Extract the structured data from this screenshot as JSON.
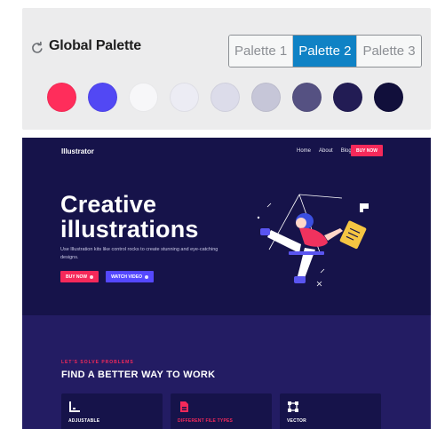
{
  "palette": {
    "title": "Global Palette",
    "tabs": [
      {
        "label": "Palette 1",
        "active": false
      },
      {
        "label": "Palette 2",
        "active": true
      },
      {
        "label": "Palette 3",
        "active": false
      }
    ],
    "swatches": [
      "#ff2d5b",
      "#5248f4",
      "#f7f7f9",
      "#ececf4",
      "#dcdcea",
      "#c6c6d8",
      "#555182",
      "#221c54",
      "#110f3b"
    ]
  },
  "site": {
    "logo": "Illustrator",
    "nav": [
      "Home",
      "About",
      "Blog"
    ],
    "nav_button": "BUY NOW",
    "hero_title_line1": "Creative",
    "hero_title_line2": "illustrations",
    "hero_subtitle": "Use Illustration kits like control rocks to create stunning and eye-catching designs.",
    "buy_button": "BUY NOW",
    "watch_button": "WATCH VIDEO",
    "eyebrow": "LET'S SOLVE PROBLEMS",
    "section_title": "FIND A BETTER WAY TO WORK",
    "features": [
      {
        "label": "ADJUSTABLE",
        "icon": "adjust-icon"
      },
      {
        "label": "DIFFERENT FILE TYPES",
        "icon": "file-icon"
      },
      {
        "label": "VECTOR",
        "icon": "vector-icon"
      }
    ]
  },
  "colors": {
    "accent_pink": "#f5295a",
    "accent_blue": "#5548ff",
    "tab_active": "#0f82c5",
    "hero_bg": "#16134a",
    "section_bg": "#231c63"
  }
}
